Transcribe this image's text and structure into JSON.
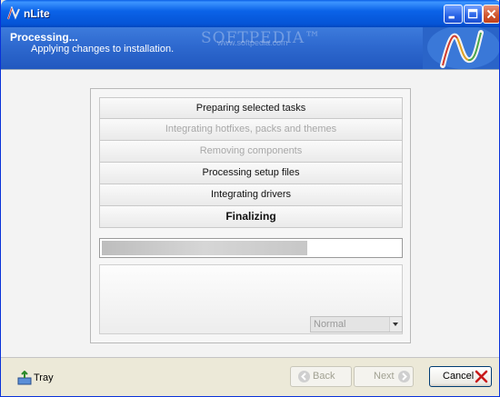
{
  "window": {
    "title": "nLite"
  },
  "header": {
    "title": "Processing...",
    "subtitle": "Applying changes to installation.",
    "watermark": "SOFTPEDIA™",
    "watermark_url": "www.softpedia.com"
  },
  "tasks": [
    {
      "label": "Preparing selected tasks",
      "state": "done"
    },
    {
      "label": "Integrating hotfixes, packs and themes",
      "state": "skipped"
    },
    {
      "label": "Removing components",
      "state": "skipped"
    },
    {
      "label": "Processing setup files",
      "state": "done"
    },
    {
      "label": "Integrating drivers",
      "state": "done"
    },
    {
      "label": "Finalizing",
      "state": "active"
    }
  ],
  "progress": {
    "value": 0.69
  },
  "log": {
    "priority_select": {
      "value": "Normal"
    }
  },
  "footer": {
    "tray_label": "Tray",
    "back_label": "Back",
    "next_label": "Next",
    "cancel_label": "Cancel"
  },
  "colors": {
    "titlebar": "#0554d6",
    "header": "#2e69cf",
    "close_button": "#d0542c"
  }
}
